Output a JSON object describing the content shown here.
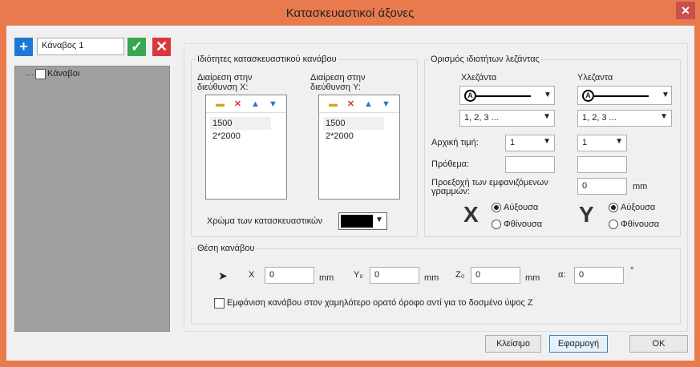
{
  "window": {
    "title": "Κατασκευαστικοί άξονες",
    "close_glyph": "✕"
  },
  "left": {
    "add_glyph": "+",
    "name_value": "Κάναβος 1",
    "ok_glyph": "✓",
    "cancel_glyph": "✕",
    "tree_root": "Κάναβοι"
  },
  "props": {
    "legend": "Ιδιότητες κατασκευαστικού κανάβου",
    "x_label": "Διαίρεση στην διεύθυνση X:",
    "y_label": "Διαίρεση στην διεύθυνση Y:",
    "x_items": [
      "1500",
      "2*2000"
    ],
    "y_items": [
      "1500",
      "2*2000"
    ],
    "color_label": "Χρώμα των κατασκευαστικών",
    "color_value": "#000000"
  },
  "legendprops": {
    "legend": "Ορισμός ιδιοτήτων λεζάντας",
    "x_header": "Χλεζάντα",
    "y_header": "Yλεζαντα",
    "symbol_letter": "A",
    "x_numbering": "1, 2, 3 ...",
    "y_numbering": "1, 2, 3 ...",
    "start_label": "Αρχική τιμή:",
    "x_start": "1",
    "y_start": "1",
    "prefix_label": "Πρόθεμα:",
    "x_prefix": "",
    "y_prefix": "",
    "extension_label": "Προεξοχή των εμφανιζόμενων γραμμών:",
    "extension_value": "0",
    "extension_unit": "mm",
    "x_big": "X",
    "y_big": "Y",
    "asc": "Αύξουσα",
    "desc": "Φθίνουσα"
  },
  "position": {
    "legend": "Θέση κανάβου",
    "x_label": "X",
    "x_value": "0",
    "y_label": "Y₀",
    "y_value": "0",
    "z_label": "Z₀",
    "z_value": "0",
    "a_label": "α:",
    "a_value": "0",
    "unit": "mm",
    "deg": "°",
    "lower_floor_label": "Εμφάνιση κανάβου στον χαμηλότερο ορατό όροφο αντί για το δοσμένο ύψος Z"
  },
  "buttons": {
    "close": "Κλείσιμο",
    "apply": "Εφαρμογή",
    "ok": "OK"
  },
  "colors": {
    "titlebar": "#e97a4e",
    "add": "#1e78d6",
    "ok": "#36a852",
    "cancel": "#d9363e"
  }
}
